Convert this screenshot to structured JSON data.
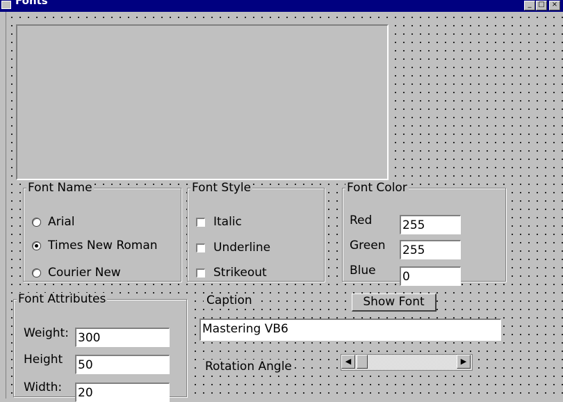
{
  "window": {
    "title": "Fonts"
  },
  "title_buttons": {
    "minimize": "_",
    "maximize": "□",
    "close": "×"
  },
  "font_name": {
    "legend": "Font Name",
    "options": [
      {
        "label": "Arial",
        "checked": false
      },
      {
        "label": "Times New Roman",
        "checked": true
      },
      {
        "label": "Courier New",
        "checked": false
      }
    ]
  },
  "font_style": {
    "legend": "Font Style",
    "options": [
      {
        "label": "Italic",
        "checked": false
      },
      {
        "label": "Underline",
        "checked": false
      },
      {
        "label": "Strikeout",
        "checked": false
      }
    ]
  },
  "font_color": {
    "legend": "Font Color",
    "red_label": "Red",
    "red_value": "255",
    "green_label": "Green",
    "green_value": "255",
    "blue_label": "Blue",
    "blue_value": "0"
  },
  "font_attributes": {
    "legend": "Font Attributes",
    "weight_label": "Weight:",
    "weight_value": "300",
    "height_label": "Height",
    "height_value": "50",
    "width_label": "Width:",
    "width_value": "20"
  },
  "caption": {
    "label": "Caption",
    "value": "Mastering VB6"
  },
  "show_font_button": "Show Font",
  "rotation": {
    "label": "Rotation Angle",
    "left_arrow": "◀",
    "right_arrow": "▶"
  }
}
